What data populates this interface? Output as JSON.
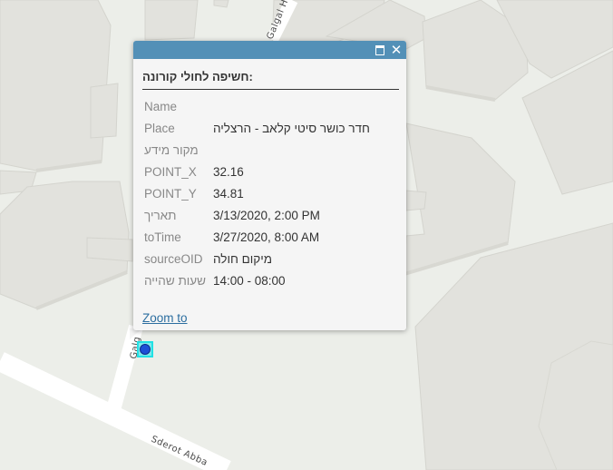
{
  "map": {
    "streets": [
      "Galgal Ha",
      "Galg",
      "Sderot Abba"
    ],
    "colors": {
      "background": "#eceee9",
      "building": "#e2e2dd",
      "building_edge": "#d2d2cc",
      "road": "#ffffff"
    }
  },
  "popup": {
    "title": ":חשיפה לחולי קורונה",
    "header_color": "#5390b7",
    "maximize_icon": "maximize-icon",
    "close_icon": "close-icon",
    "close_glyph": "✕",
    "attributes": [
      {
        "name": "Name",
        "value": ""
      },
      {
        "name": "Place",
        "value": "חדר כושר סיטי קלאב - הרצליה"
      },
      {
        "name": "מקור מידע",
        "value": ""
      },
      {
        "name": "POINT_X",
        "value": "32.16"
      },
      {
        "name": "POINT_Y",
        "value": "34.81"
      },
      {
        "name": "תאריך",
        "value": "3/13/2020, 2:00 PM"
      },
      {
        "name": "toTime",
        "value": "3/27/2020, 8:00 AM"
      },
      {
        "name": "sourceOID",
        "value": "מיקום חולה"
      },
      {
        "name": "שעות שהייה",
        "value": "14:00 - 08:00"
      }
    ],
    "zoom_link": "Zoom to"
  },
  "marker": {
    "fill": "#1c4fd6",
    "highlight": "#22e1e4"
  }
}
